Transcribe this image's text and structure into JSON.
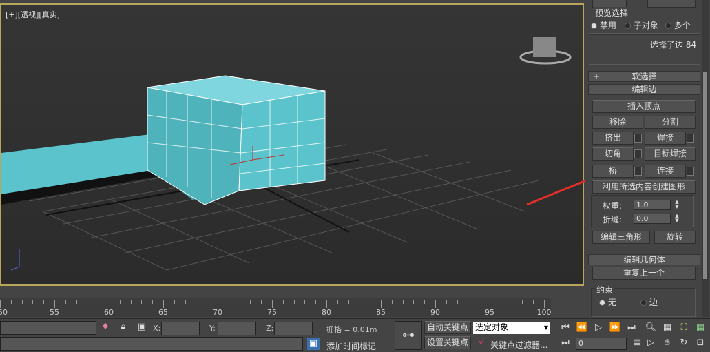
{
  "viewport": {
    "label": "[+][透视][真实]"
  },
  "panel": {
    "preview": {
      "title": "预览选择",
      "options": [
        "禁用",
        "子对象",
        "多个"
      ],
      "selected": 0
    },
    "selection_status": "选择了边 84",
    "soft_selection": {
      "sign": "+",
      "label": "软选择"
    },
    "edit_edges": {
      "sign": "-",
      "label": "编辑边",
      "insert_vertex": "插入顶点",
      "remove": "移除",
      "split": "分割",
      "extrude": "挤出",
      "weld": "焊接",
      "chamfer": "切角",
      "target_weld": "目标焊接",
      "bridge": "桥",
      "connect": "连接",
      "create_shape": "利用所选内容创建图形",
      "weight_label": "权重:",
      "weight": "1.0",
      "crease_label": "折缝:",
      "crease": "0.0",
      "edit_tri": "编辑三角形",
      "turn": "旋转"
    },
    "edit_geometry": {
      "sign": "-",
      "label": "编辑几何体",
      "repeat_last": "重复上一个",
      "constraints": {
        "title": "约束",
        "options": [
          "无",
          "边"
        ],
        "selected": 0
      }
    }
  },
  "timeline": {
    "ticks": [
      "50",
      "55",
      "60",
      "65",
      "70",
      "75",
      "80",
      "85",
      "90",
      "95",
      "100"
    ]
  },
  "status": {
    "x_label": "X:",
    "y_label": "Y:",
    "z_label": "Z:",
    "x": "",
    "y": "",
    "z": "",
    "grid": "栅格 = 0.01m",
    "add_time_tag": "添加时间标记",
    "auto_key": "自动关键点",
    "set_key": "设置关键点",
    "selected_object": "选定对象",
    "key_filters": "关键点过滤器...",
    "frame": "0"
  },
  "colors": {
    "viewport_border": "#b9a65a",
    "mesh": "#5bc3cc",
    "arrow": "#e0302a"
  }
}
